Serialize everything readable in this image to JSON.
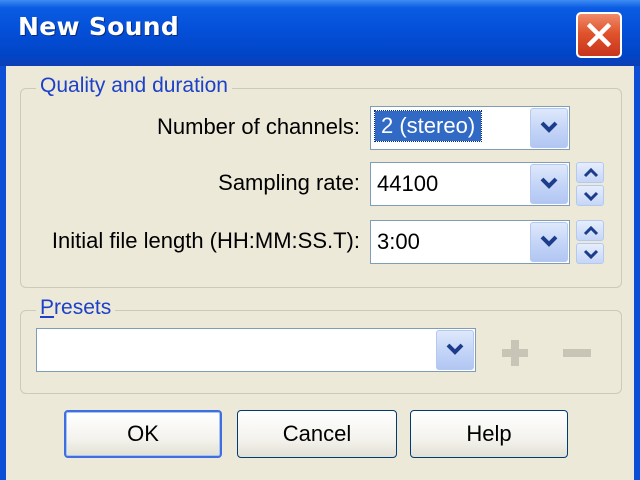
{
  "window": {
    "title": "New Sound"
  },
  "quality_group": {
    "title": "Quality and duration",
    "channels": {
      "label": "Number of channels:",
      "value": "2 (stereo)"
    },
    "sampling_rate": {
      "label": "Sampling rate:",
      "value": "44100"
    },
    "file_length": {
      "label": "Initial file length (HH:MM:SS.T):",
      "value": "3:00"
    }
  },
  "presets_group": {
    "title_first": "P",
    "title_rest": "resets",
    "value": ""
  },
  "buttons": {
    "ok": "OK",
    "cancel": "Cancel",
    "help": "Help"
  },
  "icons": {
    "close": "close-icon",
    "dropdown": "chevron-down-icon",
    "spin_up": "arrow-up-icon",
    "spin_down": "arrow-down-icon",
    "add": "plus-icon",
    "remove": "minus-icon"
  },
  "colors": {
    "titlebar": "#0550d8",
    "close_button": "#e0542c",
    "group_label": "#1d41c8",
    "selection": "#316ac5",
    "dialog_bg": "#ece9d8"
  }
}
